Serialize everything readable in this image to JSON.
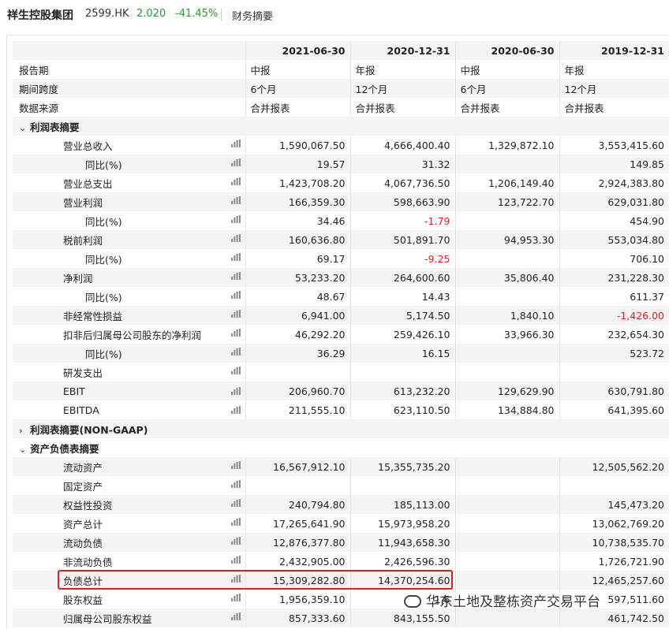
{
  "header": {
    "company": "祥生控股集团",
    "code": "2599.HK",
    "price": "2.020",
    "change": "-41.45%",
    "tab": "财务摘要"
  },
  "columns": [
    "2021-06-30",
    "2020-12-31",
    "2020-06-30",
    "2019-12-31"
  ],
  "rows": [
    {
      "label": "报告期",
      "kind": "meta",
      "values": [
        "中报",
        "年报",
        "中报",
        "年报"
      ]
    },
    {
      "label": "期间跨度",
      "kind": "meta",
      "values": [
        "6个月",
        "12个月",
        "6个月",
        "12个月"
      ]
    },
    {
      "label": "数据来源",
      "kind": "meta",
      "values": [
        "合并报表",
        "合并报表",
        "合并报表",
        "合并报表"
      ]
    },
    {
      "label": "利润表摘要",
      "kind": "section",
      "chevron": "⌄"
    },
    {
      "label": "营业总收入",
      "kind": "item",
      "values": [
        "1,590,067.50",
        "4,666,400.40",
        "1,329,872.10",
        "3,553,415.60"
      ]
    },
    {
      "label": "同比(%)",
      "kind": "sub",
      "values": [
        "19.57",
        "31.32",
        "",
        "149.85"
      ]
    },
    {
      "label": "营业总支出",
      "kind": "item",
      "values": [
        "1,423,708.20",
        "4,067,736.50",
        "1,206,149.40",
        "2,924,383.80"
      ]
    },
    {
      "label": "营业利润",
      "kind": "item",
      "values": [
        "166,359.30",
        "598,663.90",
        "123,722.70",
        "629,031.80"
      ]
    },
    {
      "label": "同比(%)",
      "kind": "sub",
      "values": [
        "34.46",
        "-1.79",
        "",
        "454.90"
      ]
    },
    {
      "label": "税前利润",
      "kind": "item",
      "values": [
        "160,636.80",
        "501,891.70",
        "94,953.30",
        "553,034.80"
      ]
    },
    {
      "label": "同比(%)",
      "kind": "sub",
      "values": [
        "69.17",
        "-9.25",
        "",
        "706.10"
      ]
    },
    {
      "label": "净利润",
      "kind": "item",
      "values": [
        "53,233.20",
        "264,600.60",
        "35,806.40",
        "231,228.30"
      ]
    },
    {
      "label": "同比(%)",
      "kind": "sub",
      "values": [
        "48.67",
        "14.43",
        "",
        "611.37"
      ]
    },
    {
      "label": "非经常性损益",
      "kind": "item",
      "values": [
        "6,941.00",
        "5,174.50",
        "1,840.10",
        "-1,426.00"
      ]
    },
    {
      "label": "扣非后归属母公司股东的净利润",
      "kind": "item",
      "values": [
        "46,292.20",
        "259,426.10",
        "33,966.30",
        "232,654.30"
      ]
    },
    {
      "label": "同比(%)",
      "kind": "sub",
      "values": [
        "36.29",
        "16.15",
        "",
        "523.72"
      ]
    },
    {
      "label": "研发支出",
      "kind": "item",
      "values": [
        "",
        "",
        "",
        ""
      ]
    },
    {
      "label": "EBIT",
      "kind": "item",
      "values": [
        "206,960.70",
        "613,232.20",
        "129,629.90",
        "630,791.80"
      ]
    },
    {
      "label": "EBITDA",
      "kind": "item",
      "values": [
        "211,555.10",
        "623,110.50",
        "134,884.80",
        "641,395.60"
      ]
    },
    {
      "label": "利润表摘要(NON-GAAP)",
      "kind": "section",
      "chevron": "›"
    },
    {
      "label": "资产负债表摘要",
      "kind": "section",
      "chevron": "⌄"
    },
    {
      "label": "流动资产",
      "kind": "item",
      "values": [
        "16,567,912.10",
        "15,355,735.20",
        "",
        "12,505,562.20"
      ]
    },
    {
      "label": "固定资产",
      "kind": "item",
      "values": [
        "",
        "",
        "",
        ""
      ]
    },
    {
      "label": "权益性投资",
      "kind": "item",
      "values": [
        "240,794.80",
        "185,113.00",
        "",
        "145,473.20"
      ]
    },
    {
      "label": "资产总计",
      "kind": "item",
      "values": [
        "17,265,641.90",
        "15,973,958.20",
        "",
        "13,062,769.20"
      ]
    },
    {
      "label": "流动负债",
      "kind": "item",
      "values": [
        "12,876,377.80",
        "11,943,658.30",
        "",
        "10,738,535.70"
      ]
    },
    {
      "label": "非流动负债",
      "kind": "item",
      "values": [
        "2,432,905.00",
        "2,426,596.30",
        "",
        "1,726,721.90"
      ]
    },
    {
      "label": "负债总计",
      "kind": "item",
      "values": [
        "15,309,282.80",
        "14,370,254.60",
        "",
        "12,465,257.60"
      ]
    },
    {
      "label": "股东权益",
      "kind": "item",
      "values": [
        "1,956,359.10",
        "1,6",
        "",
        "597,511.60"
      ]
    },
    {
      "label": "归属母公司股东权益",
      "kind": "item",
      "values": [
        "857,333.60",
        "843,155.50",
        "",
        "461,742.50"
      ]
    }
  ],
  "icons": {
    "chart": "bar-chart-icon"
  },
  "watermark": "华东土地及整栋资产交易平台",
  "colors": {
    "positive": "#2a9a2a",
    "negative": "#e02020",
    "highlight": "#e0201a"
  }
}
